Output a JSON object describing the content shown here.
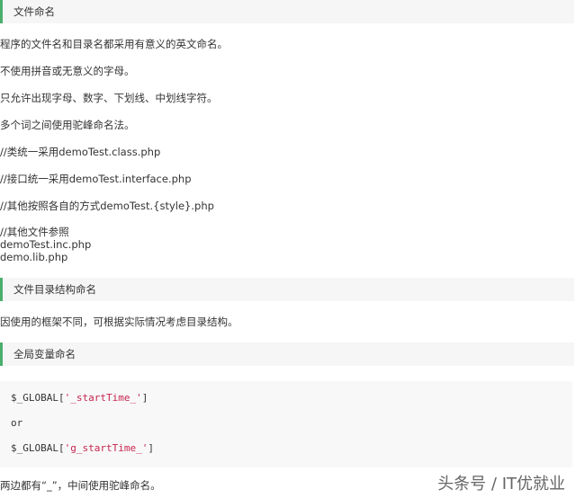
{
  "sections": {
    "file_naming": {
      "heading": "文件命名"
    },
    "dir_naming": {
      "heading": "文件目录结构命名"
    },
    "global_naming": {
      "heading": "全局变量命名"
    }
  },
  "paragraphs": {
    "p1": "程序的文件名和目录名都采用有意义的英文命名。",
    "p2": "不使用拼音或无意义的字母。",
    "p3": "只允许出现字母、数字、下划线、中划线字符。",
    "p4": "多个词之间使用驼峰命名法。",
    "p5": "//类统一采用demoTest.class.php",
    "p6": "//接口统一采用demoTest.interface.php",
    "p7": "//其他按照各自的方式demoTest.{style}.php",
    "p8a": "//其他文件参照",
    "p8b": "demoTest.inc.php",
    "p8c": "demo.lib.php",
    "p9": "因使用的框架不同，可根据实际情况考虑目录结构。",
    "p10": "两边都有“_”，中间使用驼峰命名。"
  },
  "code": {
    "l1_var": "$_GLOBAL[",
    "l1_str": "'_startTime_'",
    "l1_end": "]",
    "l2": "or",
    "l3_var": "$_GLOBAL[",
    "l3_str": "'g_startTime_'",
    "l3_end": "]"
  },
  "watermark": "头条号 / IT优就业"
}
